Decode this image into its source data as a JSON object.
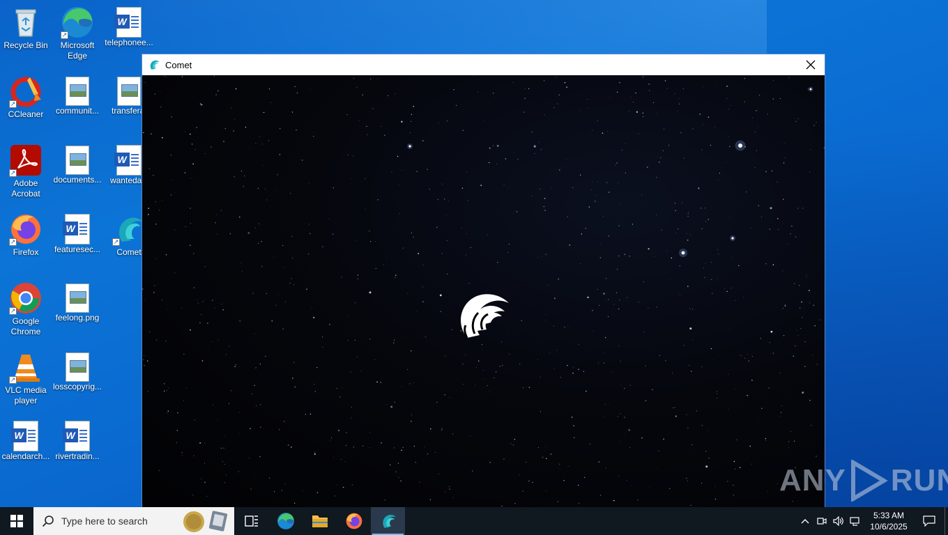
{
  "desktop": {
    "icons": [
      {
        "label": "Recycle Bin",
        "icon": "recycle-bin-icon"
      },
      {
        "label": "Microsoft Edge",
        "icon": "edge-icon"
      },
      {
        "label": "telephonee...",
        "icon": "word-doc-icon"
      },
      {
        "label": "CCleaner",
        "icon": "ccleaner-icon"
      },
      {
        "label": "communit...",
        "icon": "image-file-icon"
      },
      {
        "label": "transferal",
        "icon": "image-file-icon"
      },
      {
        "label": "Adobe Acrobat",
        "icon": "acrobat-icon"
      },
      {
        "label": "documents...",
        "icon": "image-file-icon"
      },
      {
        "label": "wantedals",
        "icon": "word-doc-icon"
      },
      {
        "label": "Firefox",
        "icon": "firefox-icon"
      },
      {
        "label": "featuresec...",
        "icon": "word-doc-icon"
      },
      {
        "label": "Comet",
        "icon": "comet-icon"
      },
      {
        "label": "Google Chrome",
        "icon": "chrome-icon"
      },
      {
        "label": "feelong.png",
        "icon": "image-file-icon"
      },
      {
        "label": "VLC media player",
        "icon": "vlc-icon"
      },
      {
        "label": "losscopyrig...",
        "icon": "image-file-icon"
      },
      {
        "label": "calendarch...",
        "icon": "word-doc-icon"
      },
      {
        "label": "rivertradin...",
        "icon": "word-doc-icon"
      }
    ]
  },
  "window": {
    "title": "Comet",
    "close_label": "×",
    "accent": "#2bb5c4"
  },
  "watermark": {
    "text_left": "ANY",
    "text_right": "RUN"
  },
  "taskbar": {
    "search_placeholder": "Type here to search",
    "pinned": [
      "task-view",
      "edge",
      "file-explorer",
      "firefox",
      "comet"
    ],
    "active": "comet",
    "clock_time": "5:33 AM",
    "clock_date": "10/6/2025"
  },
  "colors": {
    "taskbar_bg": "#101820",
    "desktop_bg": "#0a63c9"
  }
}
